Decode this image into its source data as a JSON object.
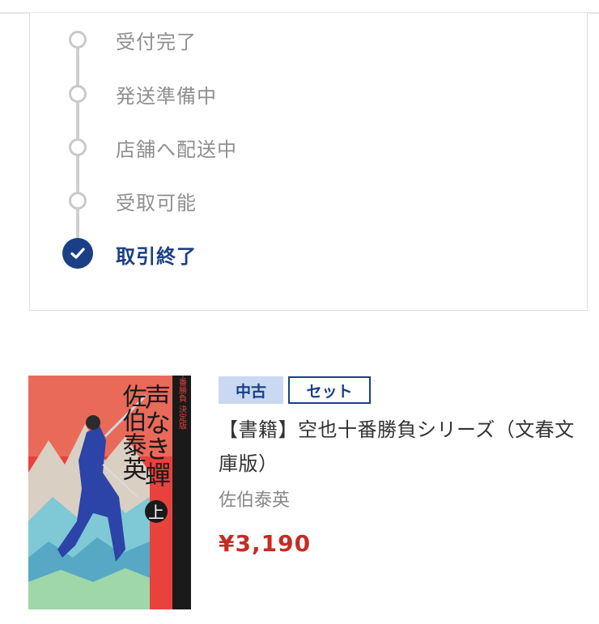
{
  "progress": {
    "steps": [
      {
        "label": "受付完了",
        "state": "inactive"
      },
      {
        "label": "発送準備中",
        "state": "inactive"
      },
      {
        "label": "店舗へ配送中",
        "state": "inactive"
      },
      {
        "label": "受取可能",
        "state": "inactive"
      },
      {
        "label": "取引終了",
        "state": "complete"
      }
    ]
  },
  "product": {
    "tags": {
      "condition": "中古",
      "type": "セット"
    },
    "title": "【書籍】空也十番勝負シリーズ（文春文庫版）",
    "author": "佐伯泰英",
    "price": "¥3,190",
    "cover": {
      "title": "声なき蟬",
      "volume": "上",
      "author": "佐伯泰英",
      "series": "空也十番勝負 決定版"
    }
  },
  "colors": {
    "accent": "#1a3f86",
    "inactive": "#c9c9c9",
    "price": "#c62c23",
    "tag_bg": "#c9d9f1"
  }
}
